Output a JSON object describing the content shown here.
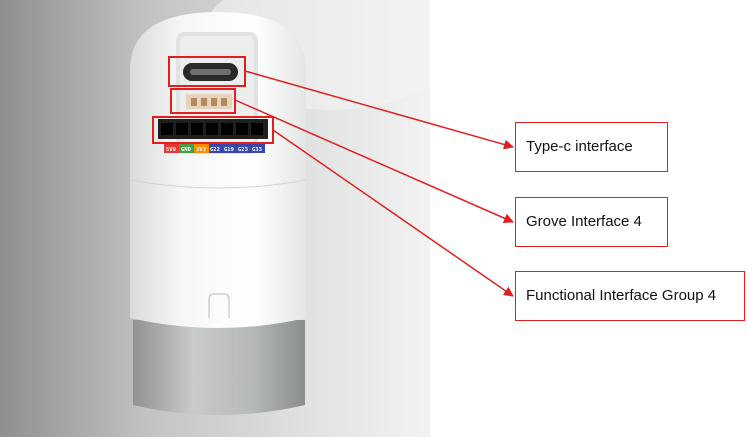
{
  "callouts": [
    {
      "label": "Type-c interface"
    },
    {
      "label": "Grove Interface 4"
    },
    {
      "label": "Functional Interface Group 4"
    }
  ],
  "pin_labels": [
    "5V0",
    "GND",
    "3V3",
    "G22",
    "G19",
    "G23",
    "G33"
  ],
  "pin_colors": [
    "#e53935",
    "#43a047",
    "#fb8c00",
    "#3949ab",
    "#3949ab",
    "#3949ab",
    "#3949ab"
  ],
  "colors": {
    "annotation": "#e02020"
  }
}
